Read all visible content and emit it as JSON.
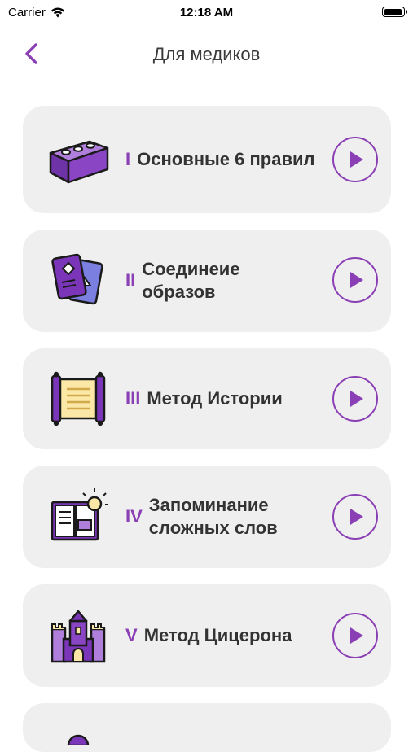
{
  "status_bar": {
    "carrier": "Carrier",
    "time": "12:18 AM"
  },
  "nav": {
    "title": "Для медиков"
  },
  "accent_color": "#8a3fb4",
  "card_background": "#efefef",
  "lessons": [
    {
      "numeral": "I",
      "title": "Основные 6 правил",
      "icon": "brick-icon"
    },
    {
      "numeral": "II",
      "title": "Соединеие образов",
      "icon": "cards-icon"
    },
    {
      "numeral": "III",
      "title": "Метод Истории",
      "icon": "scroll-icon"
    },
    {
      "numeral": "IV",
      "title": "Запоминание сложных слов",
      "icon": "book-icon"
    },
    {
      "numeral": "V",
      "title": "Метод Цицерона",
      "icon": "castle-icon"
    }
  ]
}
